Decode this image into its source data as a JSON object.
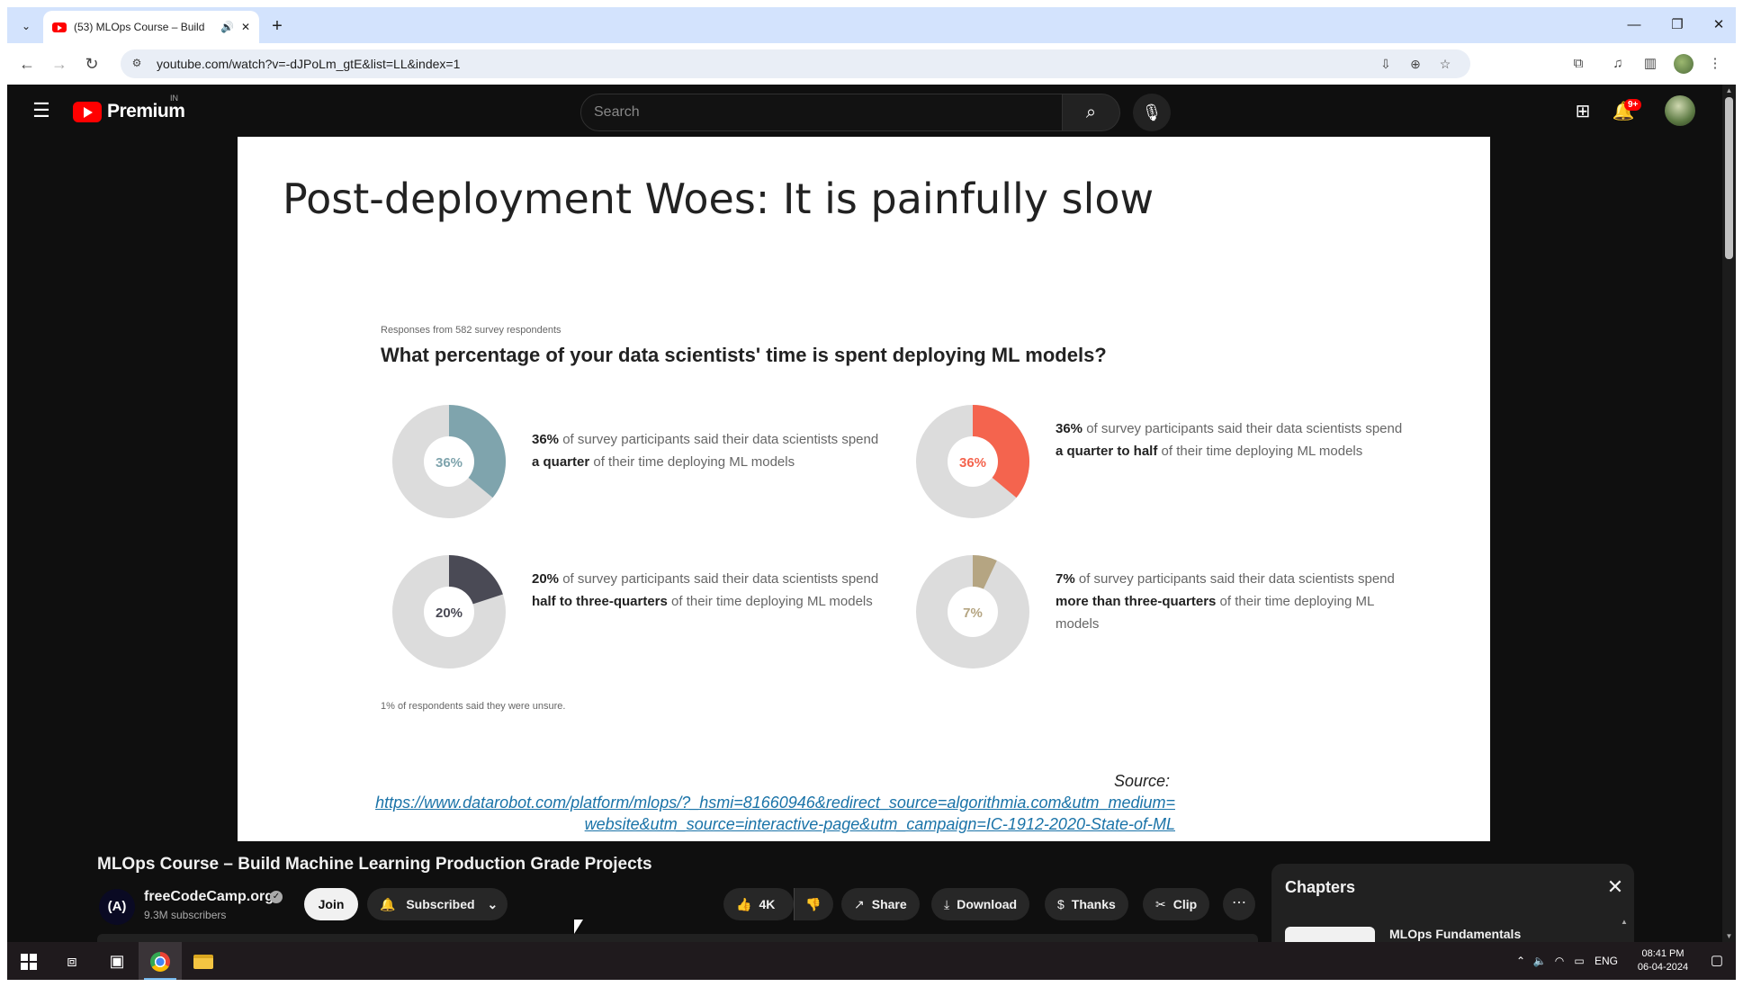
{
  "browser": {
    "tab_title": "(53) MLOps Course – Build",
    "url": "youtube.com/watch?v=-dJPoLm_gtE&list=LL&index=1"
  },
  "youtube": {
    "brand": "Premium",
    "country_code": "IN",
    "search_placeholder": "Search",
    "notification_count": "9+"
  },
  "slide": {
    "title": "Post-deployment Woes: It is painfully slow",
    "survey_note": "Responses from 582 survey respondents",
    "question": "What percentage of your data scientists' time is spent deploying ML models?",
    "stats": [
      {
        "pct_label": "36%",
        "value": 36,
        "color": "#7fa4ad",
        "lead": "36%",
        "text_a": " of survey participants said their data scientists spend ",
        "bold": "a quarter",
        "text_b": " of their time deploying ML models"
      },
      {
        "pct_label": "36%",
        "value": 36,
        "color": "#f4644e",
        "lead": "36%",
        "text_a": " of survey participants said their data scientists spend ",
        "bold": "a quarter to half",
        "text_b": " of their time deploying ML models"
      },
      {
        "pct_label": "20%",
        "value": 20,
        "color": "#4a4a55",
        "lead": "20%",
        "text_a": " of survey participants said their data scientists spend ",
        "bold": "half to three-quarters",
        "text_b": " of their time deploying ML models"
      },
      {
        "pct_label": "7%",
        "value": 7,
        "color": "#b5a582",
        "lead": "7%",
        "text_a": " of survey participants said their data scientists spend ",
        "bold": "more than three-quarters",
        "text_b": " of their time deploying ML models"
      }
    ],
    "foot_note": "1% of respondents said they were unsure.",
    "source_label": "Source:",
    "source_link_line1": "https://www.datarobot.com/platform/mlops/?_hsmi=81660946&redirect_source=algorithmia.com&utm_medium=",
    "source_link_line2": "website&utm_source=interactive-page&utm_campaign=IC-1912-2020-State-of-ML"
  },
  "video": {
    "title": "MLOps Course – Build Machine Learning Production Grade Projects",
    "channel_name": "freeCodeCamp.org",
    "channel_logo_text": "(A)",
    "subscribers": "9.3M subscribers",
    "join": "Join",
    "subscribed": "Subscribed",
    "likes": "4K",
    "share": "Share",
    "download": "Download",
    "thanks": "Thanks",
    "clip": "Clip"
  },
  "chapters": {
    "heading": "Chapters",
    "first_item": "MLOps Fundamentals"
  },
  "taskbar": {
    "language": "ENG",
    "time": "08:41 PM",
    "date": "06-04-2024"
  }
}
